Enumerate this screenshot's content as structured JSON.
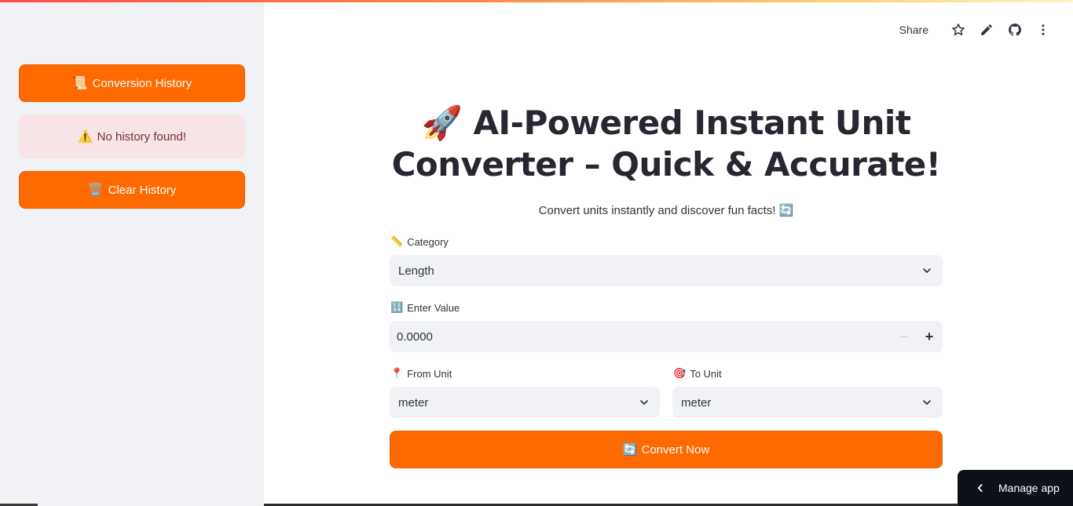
{
  "sidebar": {
    "history_button": {
      "emoji": "📜",
      "label": "Conversion History"
    },
    "warning": {
      "emoji": "⚠️",
      "text": "No history found!"
    },
    "clear_button": {
      "emoji": "🗑️",
      "label": "Clear History"
    }
  },
  "toolbar": {
    "share_label": "Share",
    "icons": [
      "star-icon",
      "edit-icon",
      "github-icon",
      "more-vertical-icon"
    ]
  },
  "main": {
    "title_emoji": "🚀",
    "title": "AI-Powered Instant Unit Converter – Quick & Accurate!",
    "subtitle": "Convert units instantly and discover fun facts! 🔄",
    "category": {
      "emoji": "📏",
      "label": "Category",
      "value": "Length"
    },
    "value_field": {
      "emoji": "🔢",
      "label": "Enter Value",
      "value": "0.0000"
    },
    "from_unit": {
      "emoji": "📍",
      "label": "From Unit",
      "value": "meter"
    },
    "to_unit": {
      "emoji": "🎯",
      "label": "To Unit",
      "value": "meter"
    },
    "convert_button": {
      "emoji": "🔄",
      "label": "Convert Now"
    }
  },
  "manage_app": {
    "label": "Manage app"
  },
  "colors": {
    "accent": "#ff6a00",
    "sidebar_bg": "#f0f2f6",
    "warning_bg": "#f6e4e6",
    "manage_bg": "#0e1117"
  }
}
